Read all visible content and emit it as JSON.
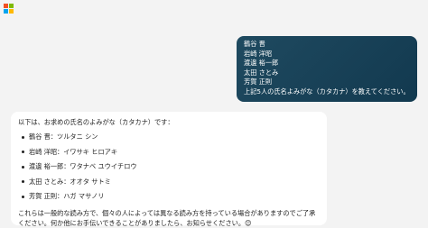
{
  "app": {
    "logo_icon": "microsoft-logo-icon",
    "logo_colors": [
      "#f25022",
      "#7fba00",
      "#00a4ef",
      "#ffb900"
    ]
  },
  "user_message": {
    "lines": [
      "鶴谷 晋",
      "岩崎 洋昭",
      "渡邊 裕一郎",
      "太田 さとみ",
      "芳賀 正則",
      "上記5人の氏名よみがな（カタカナ）を教えてください。"
    ]
  },
  "bot_message": {
    "intro": "以下は、お求めの氏名のよみがな（カタカナ）です：",
    "items": [
      "鶴谷 晋：ツルタニ シン",
      "岩崎 洋昭：イワサキ ヒロアキ",
      "渡邊 裕一郎：ワタナベ ユウイチロウ",
      "太田 さとみ：オオタ サトミ",
      "芳賀 正則：ハガ マサノリ"
    ],
    "outro": "これらは一般的な読み方で、個々の人によっては異なる読み方を持っている場合がありますのでご了承ください。何か他にお手伝いできることがありましたら、お知らせください。😊"
  }
}
